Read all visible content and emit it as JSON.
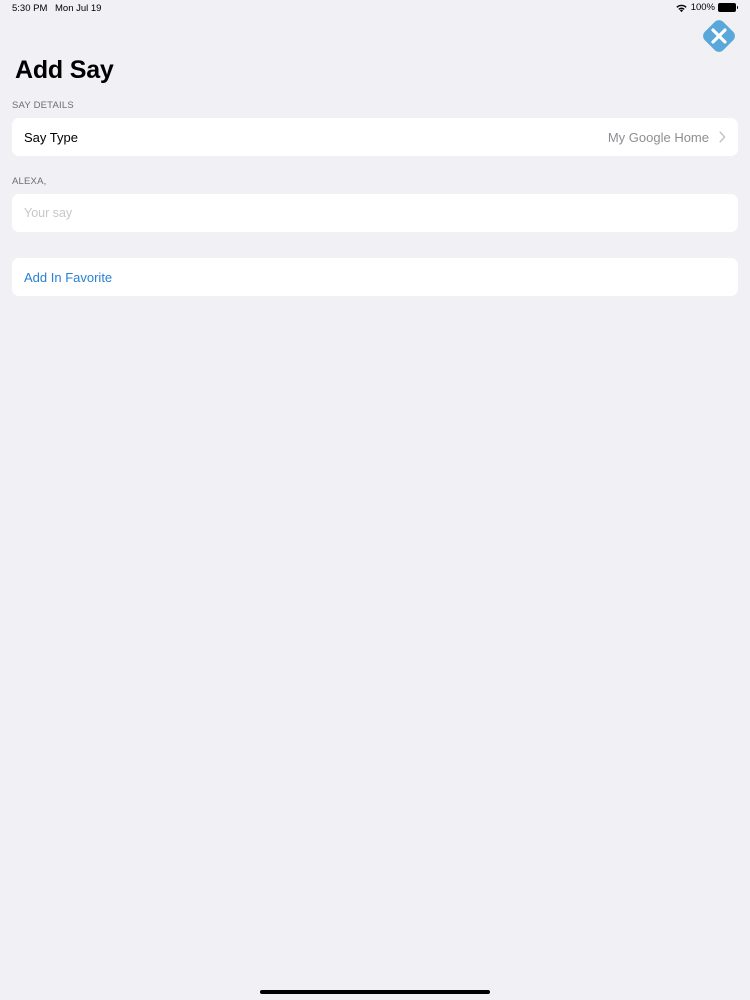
{
  "status_bar": {
    "time": "5:30 PM",
    "date": "Mon Jul 19",
    "battery_percent": "100%",
    "wifi_icon": "wifi-icon",
    "battery_icon": "battery-icon"
  },
  "close_button": {
    "icon": "close-icon",
    "color": "#5aa7d9"
  },
  "page": {
    "title": "Add Say"
  },
  "sections": {
    "say_details": {
      "header": "SAY DETAILS",
      "say_type_label": "Say Type",
      "say_type_value": "My Google Home"
    },
    "alexa": {
      "header": "ALEXA,",
      "input_value": "",
      "input_placeholder": "Your say"
    },
    "favorite": {
      "label": "Add In Favorite",
      "color": "#2a7fd4"
    }
  }
}
